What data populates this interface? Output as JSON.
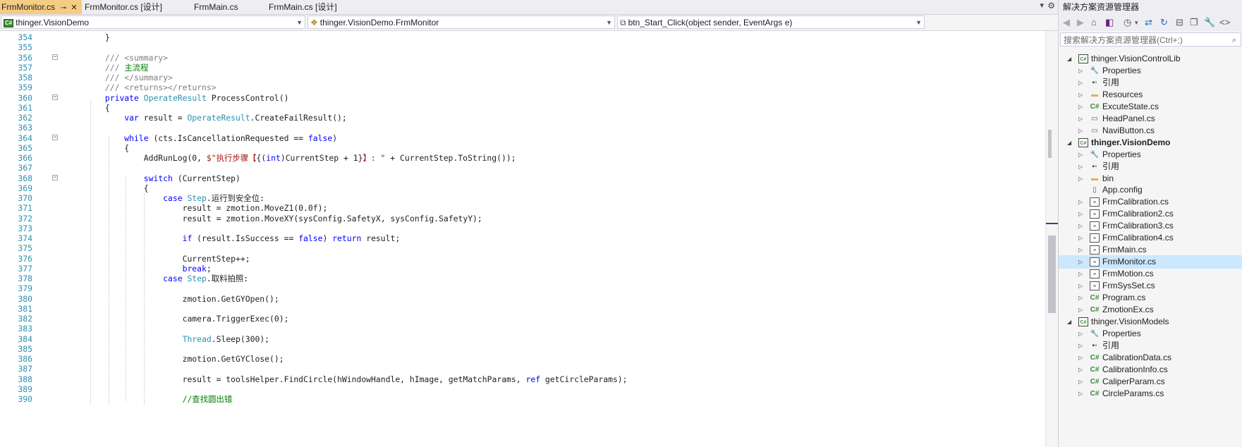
{
  "tabs": [
    {
      "label": "FrmMonitor.cs",
      "active": true
    },
    {
      "label": "FrmMonitor.cs [设计]",
      "active": false
    },
    {
      "label": "FrmMain.cs",
      "active": false
    },
    {
      "label": "FrmMain.cs [设计]",
      "active": false
    }
  ],
  "navbar": {
    "project": "thinger.VisionDemo",
    "class": "thinger.VisionDemo.FrmMonitor",
    "member": "btn_Start_Click(object sender, EventArgs e)"
  },
  "code_lines": [
    {
      "n": "354",
      "code": "        }"
    },
    {
      "n": "355",
      "code": ""
    },
    {
      "n": "356",
      "code": "        <span class=\"doc\">/// &lt;summary&gt;</span>"
    },
    {
      "n": "357",
      "code": "        <span class=\"doc\">///</span> <span class=\"cm\">主流程</span>"
    },
    {
      "n": "358",
      "code": "        <span class=\"doc\">/// &lt;/summary&gt;</span>"
    },
    {
      "n": "359",
      "code": "        <span class=\"doc\">/// &lt;returns&gt;&lt;/returns&gt;</span>"
    },
    {
      "n": "360",
      "code": "        <span class=\"kw\">private</span> <span class=\"ty\">OperateResult</span> ProcessControl()"
    },
    {
      "n": "361",
      "code": "        {"
    },
    {
      "n": "362",
      "code": "            <span class=\"kw\">var</span> result = <span class=\"ty\">OperateResult</span>.CreateFailResult();"
    },
    {
      "n": "363",
      "code": ""
    },
    {
      "n": "364",
      "code": "            <span class=\"kw\">while</span> (cts.IsCancellationRequested == <span class=\"kw\">false</span>)"
    },
    {
      "n": "365",
      "code": "            {"
    },
    {
      "n": "366",
      "code": "                AddRunLog(0, <span class=\"st\">$\"执行步骤【</span>{(<span class=\"kw\">int</span>)CurrentStep + 1}<span class=\"st\">】: \"</span> + CurrentStep.ToString());"
    },
    {
      "n": "367",
      "code": ""
    },
    {
      "n": "368",
      "code": "                <span class=\"kw\">switch</span> (CurrentStep)"
    },
    {
      "n": "369",
      "code": "                {"
    },
    {
      "n": "370",
      "code": "                    <span class=\"kw\">case</span> <span class=\"ty\">Step</span>.运行到安全位:"
    },
    {
      "n": "371",
      "code": "                        result = zmotion.MoveZ1(0.0f);"
    },
    {
      "n": "372",
      "code": "                        result = zmotion.MoveXY(sysConfig.SafetyX, sysConfig.SafetyY);"
    },
    {
      "n": "373",
      "code": ""
    },
    {
      "n": "374",
      "code": "                        <span class=\"kw\">if</span> (result.IsSuccess == <span class=\"kw\">false</span>) <span class=\"kw\">return</span> result;"
    },
    {
      "n": "375",
      "code": ""
    },
    {
      "n": "376",
      "code": "                        CurrentStep++;"
    },
    {
      "n": "377",
      "code": "                        <span class=\"kw\">break</span>;"
    },
    {
      "n": "378",
      "code": "                    <span class=\"kw\">case</span> <span class=\"ty\">Step</span>.取料拍照:"
    },
    {
      "n": "379",
      "code": ""
    },
    {
      "n": "380",
      "code": "                        zmotion.GetGYOpen();"
    },
    {
      "n": "381",
      "code": ""
    },
    {
      "n": "382",
      "code": "                        camera.TriggerExec(0);"
    },
    {
      "n": "383",
      "code": ""
    },
    {
      "n": "384",
      "code": "                        <span class=\"ty\">Thread</span>.Sleep(300);"
    },
    {
      "n": "385",
      "code": ""
    },
    {
      "n": "386",
      "code": "                        zmotion.GetGYClose();"
    },
    {
      "n": "387",
      "code": ""
    },
    {
      "n": "388",
      "code": "                        result = toolsHelper.FindCircle(hWindowHandle, hImage, getMatchParams, <span class=\"kw\">ref</span> getCircleParams);"
    },
    {
      "n": "389",
      "code": ""
    },
    {
      "n": "390",
      "code": "                        <span class=\"cm\">//查找圆出错</span>"
    }
  ],
  "explorer": {
    "title": "解决方案资源管理器",
    "search_placeholder": "搜索解决方案资源管理器(Ctrl+;)",
    "tree": [
      {
        "label": "thinger.VisionControlLib",
        "icon": "project-icon",
        "level": 0,
        "expanded": true,
        "bold": false
      },
      {
        "label": "Properties",
        "icon": "wrench-icon",
        "level": 1
      },
      {
        "label": "引用",
        "icon": "reference-icon",
        "level": 1
      },
      {
        "label": "Resources",
        "icon": "folder-icon",
        "level": 1
      },
      {
        "label": "ExcuteState.cs",
        "icon": "csharp-file-icon",
        "level": 1
      },
      {
        "label": "HeadPanel.cs",
        "icon": "panel-file-icon",
        "level": 1
      },
      {
        "label": "NaviButton.cs",
        "icon": "panel-file-icon",
        "level": 1
      },
      {
        "label": "thinger.VisionDemo",
        "icon": "project-icon",
        "level": 0,
        "expanded": true,
        "bold": true
      },
      {
        "label": "Properties",
        "icon": "wrench-icon",
        "level": 1
      },
      {
        "label": "引用",
        "icon": "reference-icon",
        "level": 1
      },
      {
        "label": "bin",
        "icon": "folder-icon",
        "level": 1
      },
      {
        "label": "App.config",
        "icon": "config-file-icon",
        "level": 1,
        "noexpand": true
      },
      {
        "label": "FrmCalibration.cs",
        "icon": "form-file-icon",
        "level": 1
      },
      {
        "label": "FrmCalibration2.cs",
        "icon": "form-file-icon",
        "level": 1
      },
      {
        "label": "FrmCalibration3.cs",
        "icon": "form-file-icon",
        "level": 1
      },
      {
        "label": "FrmCalibration4.cs",
        "icon": "form-file-icon",
        "level": 1
      },
      {
        "label": "FrmMain.cs",
        "icon": "form-file-icon",
        "level": 1
      },
      {
        "label": "FrmMonitor.cs",
        "icon": "form-file-icon",
        "level": 1,
        "selected": true
      },
      {
        "label": "FrmMotion.cs",
        "icon": "form-file-icon",
        "level": 1
      },
      {
        "label": "FrmSysSet.cs",
        "icon": "form-file-icon",
        "level": 1
      },
      {
        "label": "Program.cs",
        "icon": "csharp-file-icon",
        "level": 1
      },
      {
        "label": "ZmotionEx.cs",
        "icon": "csharp-file-icon",
        "level": 1
      },
      {
        "label": "thinger.VisionModels",
        "icon": "project-icon",
        "level": 0,
        "expanded": true,
        "bold": false
      },
      {
        "label": "Properties",
        "icon": "wrench-icon",
        "level": 1
      },
      {
        "label": "引用",
        "icon": "reference-icon",
        "level": 1
      },
      {
        "label": "CalibrationData.cs",
        "icon": "csharp-file-icon",
        "level": 1
      },
      {
        "label": "CalibrationInfo.cs",
        "icon": "csharp-file-icon",
        "level": 1
      },
      {
        "label": "CaliperParam.cs",
        "icon": "csharp-file-icon",
        "level": 1
      },
      {
        "label": "CircleParams.cs",
        "icon": "csharp-file-icon",
        "level": 1
      }
    ]
  }
}
